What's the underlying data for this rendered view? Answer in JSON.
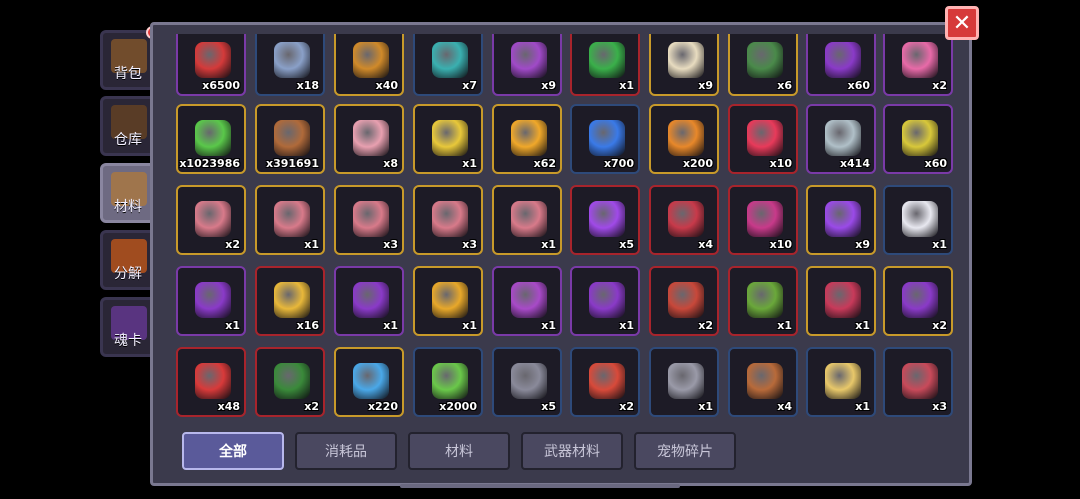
{
  "side_tabs": [
    {
      "label": "背包",
      "active": false,
      "icon": "chest-icon",
      "color": "#8a5a2a"
    },
    {
      "label": "仓库",
      "active": false,
      "icon": "warehouse-icon",
      "color": "#6a4422"
    },
    {
      "label": "材料",
      "active": true,
      "icon": "material-crate-icon",
      "color": "#b07a3a"
    },
    {
      "label": "分解",
      "active": false,
      "icon": "pumpkin-furnace-icon",
      "color": "#c85a18"
    },
    {
      "label": "魂卡",
      "active": false,
      "icon": "soul-card-icon",
      "color": "#6a3a9a"
    }
  ],
  "close_label": "✕",
  "items": [
    [
      {
        "count": "x6500",
        "icon": "medal-icon",
        "color": "#d43a3a",
        "rarity": "r-purple"
      },
      {
        "count": "x18",
        "icon": "robot-head-icon",
        "color": "#8aa0c8",
        "rarity": "r-blue"
      },
      {
        "count": "x40",
        "icon": "gold-chest-icon",
        "color": "#d08a2a",
        "rarity": "r-gold"
      },
      {
        "count": "x7",
        "icon": "tech-cube-icon",
        "color": "#3ab0b0",
        "rarity": "r-blue"
      },
      {
        "count": "x9",
        "icon": "purple-box-icon",
        "color": "#a04ac8",
        "rarity": "r-purple"
      },
      {
        "count": "x1",
        "icon": "green-rune-icon",
        "color": "#3ab04a",
        "rarity": "r-red"
      },
      {
        "count": "x9",
        "icon": "priest-figure-icon",
        "color": "#e8dcc0",
        "rarity": "r-gold"
      },
      {
        "count": "x6",
        "icon": "goblin-figure-icon",
        "color": "#4a8a4a",
        "rarity": "r-gold"
      },
      {
        "count": "x60",
        "icon": "purple-demon-icon",
        "color": "#8a3ac8",
        "rarity": "r-purple"
      },
      {
        "count": "x2",
        "icon": "pink-paw-icon",
        "color": "#e86aa8",
        "rarity": "r-purple"
      }
    ],
    [
      {
        "count": "x1023986",
        "icon": "green-slime-coin-icon",
        "color": "#5ac84a",
        "rarity": "r-gold"
      },
      {
        "count": "x391691",
        "icon": "brown-hide-icon",
        "color": "#b06a3a",
        "rarity": "r-gold"
      },
      {
        "count": "x8",
        "icon": "pink-hide-icon",
        "color": "#e8a0b0",
        "rarity": "r-gold"
      },
      {
        "count": "x1",
        "icon": "gold-cross-icon",
        "color": "#e8c83a",
        "rarity": "r-gold"
      },
      {
        "count": "x62",
        "icon": "gold-gem-icon",
        "color": "#f0a82a",
        "rarity": "r-gold"
      },
      {
        "count": "x700",
        "icon": "blue-crystal-icon",
        "color": "#3a7ae8",
        "rarity": "r-blue"
      },
      {
        "count": "x200",
        "icon": "orange-crystal-icon",
        "color": "#e8882a",
        "rarity": "r-gold"
      },
      {
        "count": "x10",
        "icon": "red-crystal-icon",
        "color": "#e83a5a",
        "rarity": "r-red"
      },
      {
        "count": "x414",
        "icon": "silver-ore-icon",
        "color": "#b0c0c8",
        "rarity": "r-purple"
      },
      {
        "count": "x60",
        "icon": "gold-ore-icon",
        "color": "#d8c83a",
        "rarity": "r-purple"
      }
    ],
    [
      {
        "count": "x2",
        "icon": "pink-helmet-box-icon",
        "color": "#d87a8a",
        "rarity": "r-gold"
      },
      {
        "count": "x1",
        "icon": "pink-armor-box-icon",
        "color": "#d87a8a",
        "rarity": "r-gold"
      },
      {
        "count": "x3",
        "icon": "pink-ring-box-icon",
        "color": "#d87a8a",
        "rarity": "r-gold"
      },
      {
        "count": "x3",
        "icon": "pink-amulet-box-icon",
        "color": "#d87a8a",
        "rarity": "r-gold"
      },
      {
        "count": "x1",
        "icon": "pink-boots-box-icon",
        "color": "#d87a8a",
        "rarity": "r-gold"
      },
      {
        "count": "x5",
        "icon": "purple-battery-icon",
        "color": "#a04ae8",
        "rarity": "r-red"
      },
      {
        "count": "x4",
        "icon": "red-card-icon",
        "color": "#c83a4a",
        "rarity": "r-red"
      },
      {
        "count": "x10",
        "icon": "purple-card-icon",
        "color": "#c83a8a",
        "rarity": "r-red"
      },
      {
        "count": "x9",
        "icon": "purple-spellbook-icon",
        "color": "#9a4ae8",
        "rarity": "r-gold"
      },
      {
        "count": "x1",
        "icon": "white-egg-icon",
        "color": "#e8e8f0",
        "rarity": "r-blue"
      }
    ],
    [
      {
        "count": "x1",
        "icon": "purple-mystery-book-icon",
        "color": "#8a3ac8",
        "rarity": "r-purple"
      },
      {
        "count": "x16",
        "icon": "gold-keyhole-icon",
        "color": "#e8b83a",
        "rarity": "r-red"
      },
      {
        "count": "x1",
        "icon": "purple-mystery-box-icon",
        "color": "#8a3ac8",
        "rarity": "r-purple"
      },
      {
        "count": "x1",
        "icon": "gold-mystery-box-icon",
        "color": "#e8a82a",
        "rarity": "r-gold"
      },
      {
        "count": "x1",
        "icon": "spider-mech-icon",
        "color": "#a84ac8",
        "rarity": "r-purple"
      },
      {
        "count": "x1",
        "icon": "purple-mystery-book-2-icon",
        "color": "#8a3ac8",
        "rarity": "r-purple"
      },
      {
        "count": "x2",
        "icon": "red-tome-icon",
        "color": "#c8483a",
        "rarity": "r-red"
      },
      {
        "count": "x1",
        "icon": "green-key-book-icon",
        "color": "#6aa83a",
        "rarity": "r-red"
      },
      {
        "count": "x1",
        "icon": "red-treasure-chest-icon",
        "color": "#c83a5a",
        "rarity": "r-gold"
      },
      {
        "count": "x2",
        "icon": "purple-treasure-chest-icon",
        "color": "#8a3ac8",
        "rarity": "r-gold"
      }
    ],
    [
      {
        "count": "x48",
        "icon": "red-question-icon",
        "color": "#d83a3a",
        "rarity": "r-red"
      },
      {
        "count": "x2",
        "icon": "green-clover-icon",
        "color": "#3a8a3a",
        "rarity": "r-red"
      },
      {
        "count": "x220",
        "icon": "star-jar-icon",
        "color": "#4aa8e8",
        "rarity": "r-gold"
      },
      {
        "count": "x2000",
        "icon": "green-arrow-coin-icon",
        "color": "#6ac84a",
        "rarity": "r-blue"
      },
      {
        "count": "x5",
        "icon": "gun-part-icon",
        "color": "#8a8a9a",
        "rarity": "r-blue"
      },
      {
        "count": "x2",
        "icon": "red-blade-icon",
        "color": "#d84a3a",
        "rarity": "r-blue"
      },
      {
        "count": "x1",
        "icon": "barrel-part-icon",
        "color": "#9a9aa8",
        "rarity": "r-blue"
      },
      {
        "count": "x4",
        "icon": "rifle-part-icon",
        "color": "#b86a3a",
        "rarity": "r-blue"
      },
      {
        "count": "x1",
        "icon": "gold-bullet-icon",
        "color": "#e8c86a",
        "rarity": "r-blue"
      },
      {
        "count": "x3",
        "icon": "red-spear-tip-icon",
        "color": "#c84a5a",
        "rarity": "r-blue"
      }
    ]
  ],
  "filter_tabs": [
    {
      "label": "全部",
      "active": true
    },
    {
      "label": "消耗品",
      "active": false
    },
    {
      "label": "材料",
      "active": false
    },
    {
      "label": "武器材料",
      "active": false
    },
    {
      "label": "宠物碎片",
      "active": false
    }
  ]
}
